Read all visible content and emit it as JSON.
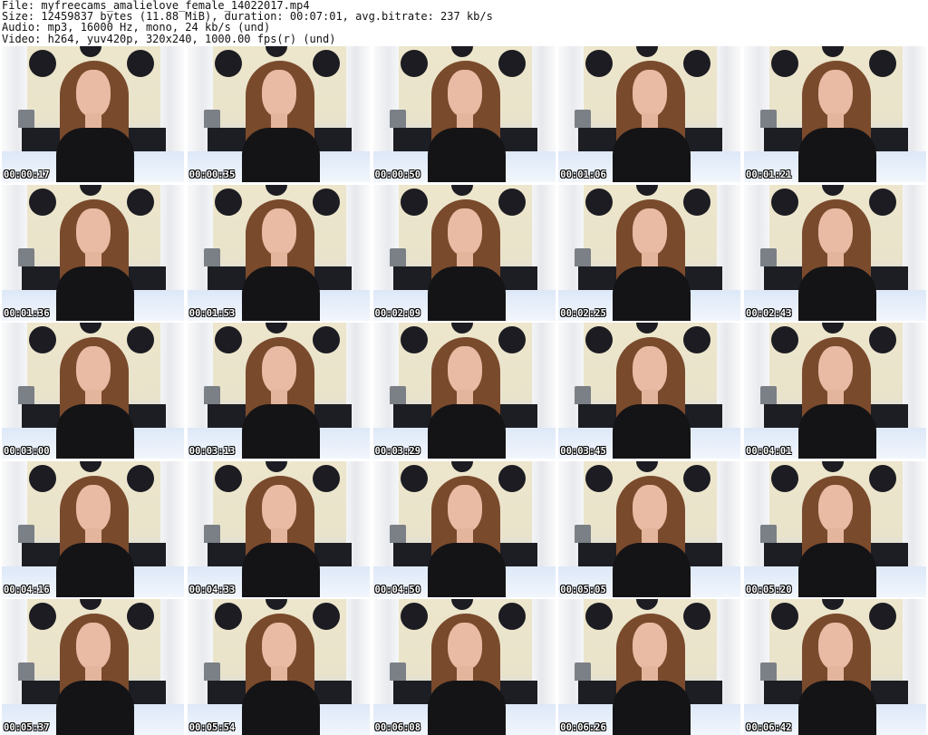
{
  "header": {
    "file": "File: myfreecams_amalielove_female_14022017.mp4",
    "size": "Size: 12459837 bytes (11.88 MiB), duration: 00:07:01, avg.bitrate: 237 kb/s",
    "audio": "Audio: mp3, 16000 Hz, mono, 24 kb/s (und)",
    "video": "Video: h264, yuv420p, 320x240, 1000.00 fps(r) (und)"
  },
  "thumbnails": [
    {
      "timestamp": "00:00:17"
    },
    {
      "timestamp": "00:00:35"
    },
    {
      "timestamp": "00:00:50"
    },
    {
      "timestamp": "00:01:06"
    },
    {
      "timestamp": "00:01:21"
    },
    {
      "timestamp": "00:01:36"
    },
    {
      "timestamp": "00:01:53"
    },
    {
      "timestamp": "00:02:09"
    },
    {
      "timestamp": "00:02:25"
    },
    {
      "timestamp": "00:02:43"
    },
    {
      "timestamp": "00:03:00"
    },
    {
      "timestamp": "00:03:13"
    },
    {
      "timestamp": "00:03:29"
    },
    {
      "timestamp": "00:03:45"
    },
    {
      "timestamp": "00:04:01"
    },
    {
      "timestamp": "00:04:16"
    },
    {
      "timestamp": "00:04:33"
    },
    {
      "timestamp": "00:04:50"
    },
    {
      "timestamp": "00:05:05"
    },
    {
      "timestamp": "00:05:20"
    },
    {
      "timestamp": "00:05:37"
    },
    {
      "timestamp": "00:05:54"
    },
    {
      "timestamp": "00:06:08"
    },
    {
      "timestamp": "00:06:26"
    },
    {
      "timestamp": "00:06:42"
    }
  ]
}
